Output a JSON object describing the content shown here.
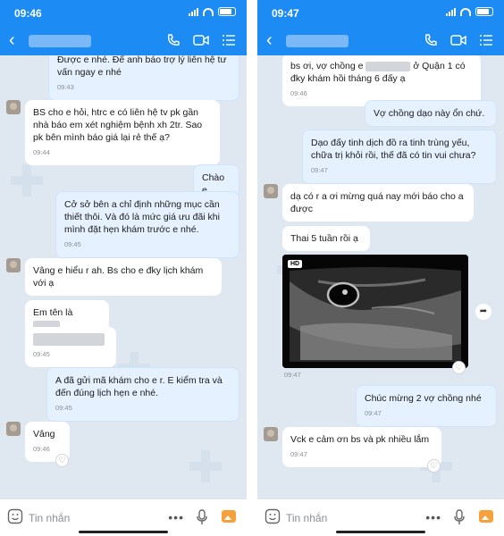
{
  "left": {
    "time": "09:46",
    "messages": [
      {
        "dir": "out",
        "text": "Được e nhé. Để anh báo trợ lý liên hệ tư vấn ngay e nhé",
        "time": "09:43"
      },
      {
        "dir": "in",
        "text": "BS cho e hỏi, htrc e có liên hệ tv pk gần nhà báo em xét nghiệm bệnh xh 2tr. Sao pk bên mình báo giá lại rẻ thế ạ?",
        "time": "09:44"
      },
      {
        "dir": "out",
        "text": "Chào e"
      },
      {
        "dir": "out",
        "text": "Cở sở bên a chỉ định những mục cần thiết thôi. Và đó là mức giá ưu đãi khi mình đặt hẹn khám trước e nhé.",
        "time": "09:45"
      },
      {
        "dir": "in",
        "text": "Vâng e hiểu r ah. Bs cho e đky lịch khám với ạ"
      },
      {
        "dir": "in",
        "text": "Em tên là"
      },
      {
        "dir": "in",
        "text": "",
        "time": "09:45"
      },
      {
        "dir": "out",
        "text": "A đã gửi mã khám cho e r. E kiểm tra và đến đúng lịch hẹn e nhé.",
        "time": "09:45"
      },
      {
        "dir": "in",
        "text": "Vâng",
        "time": "09:46"
      }
    ],
    "input_placeholder": "Tin nhắn"
  },
  "right": {
    "time": "09:47",
    "messages": [
      {
        "dir": "in",
        "text_a": "bs ơi, vợ chồng e",
        "text_b": "ở Quận 1 có đky khám hồi tháng 6 đấy ạ",
        "time": "09:46"
      },
      {
        "dir": "out",
        "text": "Vợ chồng dạo này ổn chứ."
      },
      {
        "dir": "out",
        "text": "Dạo đấy tinh dịch đồ ra tinh trùng yếu, chữa trị khỏi rồi, thế đã có tin vui chưa?",
        "time": "09:47"
      },
      {
        "dir": "in",
        "text": "dạ có r a ơi mừng quá nay mới báo cho a được"
      },
      {
        "dir": "in",
        "text": "Thai 5 tuần rồi ạ"
      },
      {
        "dir": "in",
        "type": "image",
        "badge": "HD",
        "time": "09:47"
      },
      {
        "dir": "out",
        "text": "Chúc mừng 2 vợ chồng nhé",
        "time": "09:47"
      },
      {
        "dir": "in",
        "text": "Vck e cảm ơn bs và pk nhiều lắm",
        "time": "09:47"
      }
    ],
    "input_placeholder": "Tin nhắn"
  },
  "icons": {
    "back": "back-arrow-icon",
    "call": "phone-icon",
    "video": "video-camera-icon",
    "menu": "list-menu-icon",
    "emoji": "emoji-icon",
    "more": "more-dots-icon",
    "mic": "microphone-icon",
    "image": "image-icon",
    "heart": "heart-icon",
    "share": "share-arrow-icon"
  },
  "colors": {
    "header": "#1c8cf4",
    "chat_bg": "#dfe8f1",
    "bubble_out": "#e5f1ff",
    "bubble_in": "#ffffff"
  }
}
